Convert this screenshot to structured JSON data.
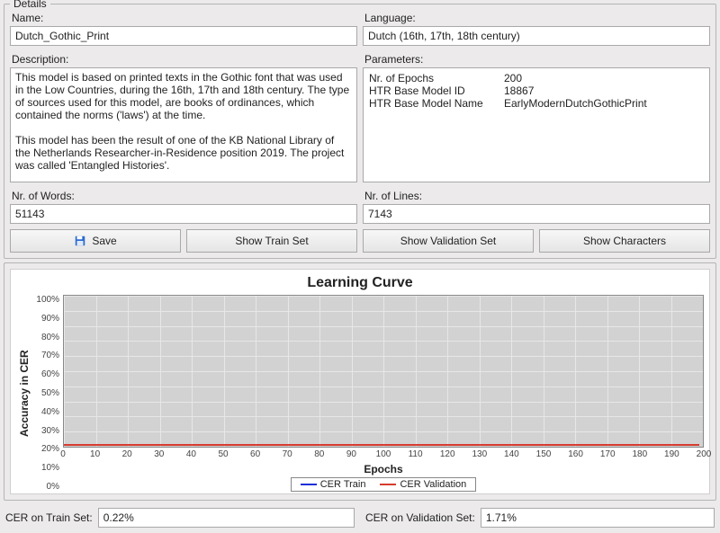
{
  "details": {
    "title": "Details",
    "name_label": "Name:",
    "name_value": "Dutch_Gothic_Print",
    "language_label": "Language:",
    "language_value": "Dutch (16th, 17th, 18th century)",
    "description_label": "Description:",
    "description_value": "This model is based on printed texts in the Gothic font that was used in the Low Countries, during the 16th, 17th and 18th century. The type of sources used for this model, are books of ordinances, which contained the norms ('laws') at the time.\n\nThis model has been the result of one of the KB National Library of the Netherlands Researcher-in-Residence position 2019. The project was called 'Entangled Histories'.",
    "parameters_label": "Parameters:",
    "parameters": [
      {
        "key": "Nr. of Epochs",
        "val": "200"
      },
      {
        "key": "HTR Base Model ID",
        "val": "18867"
      },
      {
        "key": "HTR Base Model Name",
        "val": "EarlyModernDutchGothicPrint"
      }
    ],
    "words_label": "Nr. of Words:",
    "words_value": "51143",
    "lines_label": "Nr. of Lines:",
    "lines_value": "7143",
    "buttons": {
      "save": "Save",
      "train": "Show Train Set",
      "validation": "Show Validation Set",
      "chars": "Show Characters"
    }
  },
  "chart_data": {
    "type": "line",
    "title": "Learning Curve",
    "xlabel": "Epochs",
    "ylabel": "Accuracy in CER",
    "x": [
      0,
      10,
      20,
      30,
      40,
      50,
      60,
      70,
      80,
      90,
      100,
      110,
      120,
      130,
      140,
      150,
      160,
      170,
      180,
      190,
      200
    ],
    "ylim": [
      0,
      100
    ],
    "yticks": [
      "100%",
      "90%",
      "80%",
      "70%",
      "60%",
      "50%",
      "40%",
      "30%",
      "20%",
      "10%",
      "0%"
    ],
    "series": [
      {
        "name": "CER Train",
        "color": "#1a2fd8",
        "approx_final": 0.22
      },
      {
        "name": "CER Validation",
        "color": "#d63b2f",
        "approx_final": 1.71
      }
    ],
    "marker_epoch": 200,
    "marker_color": "#1bcf1b"
  },
  "metrics": {
    "train_label": "CER on Train Set:",
    "train_value": "0.22%",
    "val_label": "CER on Validation Set:",
    "val_value": "1.71%"
  }
}
